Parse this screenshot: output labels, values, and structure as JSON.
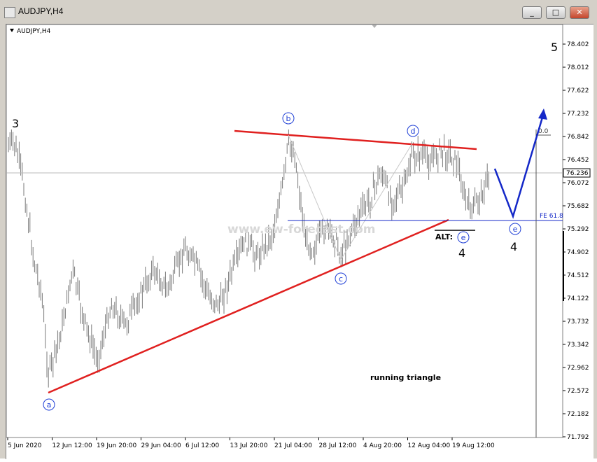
{
  "window": {
    "title": "AUDJPY,H4",
    "buttons": [
      "_",
      "□",
      "✕"
    ]
  },
  "chart_data": {
    "type": "candlestick",
    "symbol_label": "AUDJPY,H4",
    "current_price": "76.236",
    "y_ticks": [
      "78.402",
      "78.012",
      "77.622",
      "77.232",
      "76.842",
      "76.452",
      "76.072",
      "75.682",
      "75.292",
      "74.902",
      "74.512",
      "74.122",
      "73.732",
      "73.342",
      "72.962",
      "72.572",
      "72.182",
      "71.792"
    ],
    "ylim": [
      71.792,
      78.402
    ],
    "x_ticks": [
      "5 Jun 2020",
      "12 Jun 12:00",
      "19 Jun 20:00",
      "29 Jun 04:00",
      "6 Jul 12:00",
      "13 Jul 20:00",
      "21 Jul 04:00",
      "28 Jul 12:00",
      "4 Aug 20:00",
      "12 Aug 04:00",
      "19 Aug 12:00"
    ],
    "wave_labels": {
      "a": "a",
      "b": "b",
      "c": "c",
      "d": "d",
      "e": "e",
      "alt_e": "e",
      "proj_e": "e",
      "three": "3",
      "four": "4",
      "alt_four": "4",
      "five": "5"
    },
    "annotations": {
      "alt": "ALT:",
      "pattern": "running triangle",
      "fe_level": "FE 61.8",
      "target": "0.0",
      "watermark": "www.ew-forecast.com"
    },
    "key_points": {
      "a_low": 72.55,
      "b_high": 76.85,
      "c_low": 74.8,
      "d_high": 76.7,
      "fe_61_8": 75.45,
      "projected_e": 75.5,
      "target_0": 76.842
    }
  },
  "colors": {
    "candle": "#7a7a7a",
    "triangle_line": "#e0201f",
    "wave_label": "#1f3fd6",
    "projection": "#1428c8",
    "current_price_line": "#b8b8b8"
  }
}
